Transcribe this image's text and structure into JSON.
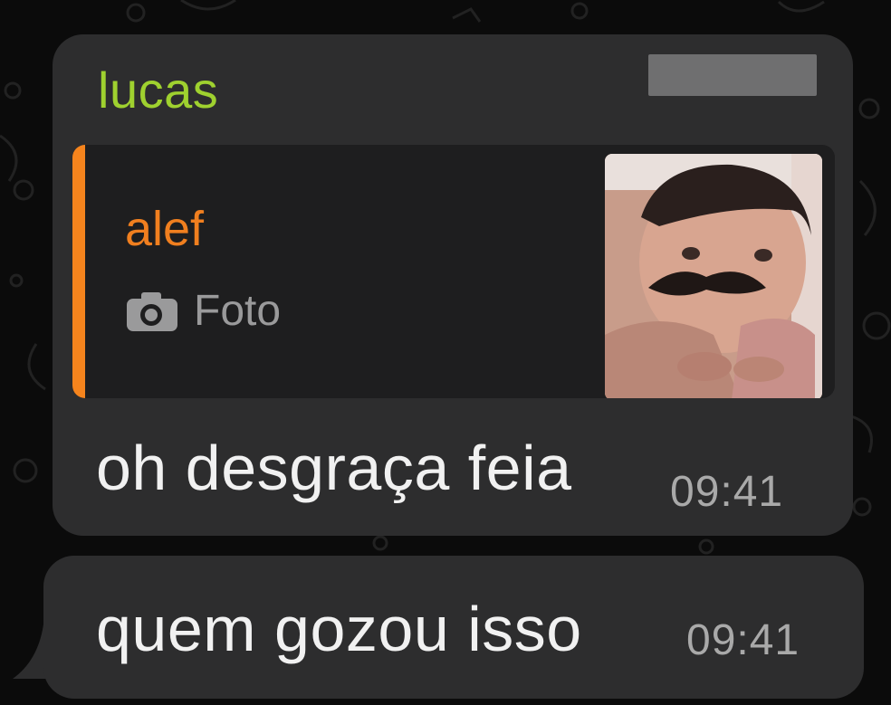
{
  "messages": [
    {
      "sender": "lucas",
      "reply": {
        "author": "alef",
        "media_type": "Foto",
        "icon": "camera-icon"
      },
      "text": "oh desgraça feia",
      "time": "09:41"
    },
    {
      "text": "quem gozou isso",
      "time": "09:41"
    }
  ],
  "colors": {
    "background": "#0b0b0b",
    "bubble": "#2d2d2e",
    "quote_background": "#1e1e1f",
    "sender_name": "#9fd12f",
    "quote_author": "#f07f1f",
    "quote_bar": "#f5841d",
    "message_text": "#f1f1f1",
    "timestamp": "#a9a9a9"
  }
}
